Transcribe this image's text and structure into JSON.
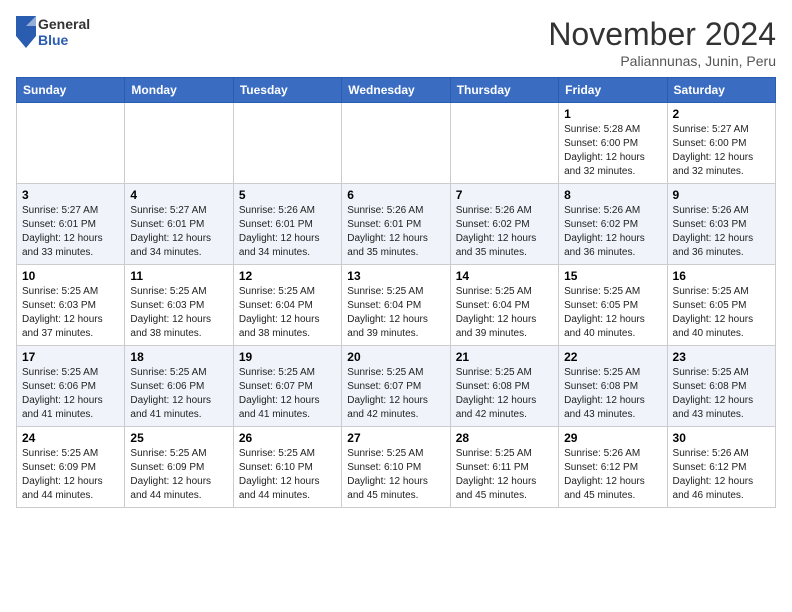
{
  "header": {
    "logo_general": "General",
    "logo_blue": "Blue",
    "month": "November 2024",
    "location": "Paliannunas, Junin, Peru"
  },
  "weekdays": [
    "Sunday",
    "Monday",
    "Tuesday",
    "Wednesday",
    "Thursday",
    "Friday",
    "Saturday"
  ],
  "weeks": [
    [
      {
        "day": "",
        "info": ""
      },
      {
        "day": "",
        "info": ""
      },
      {
        "day": "",
        "info": ""
      },
      {
        "day": "",
        "info": ""
      },
      {
        "day": "",
        "info": ""
      },
      {
        "day": "1",
        "info": "Sunrise: 5:28 AM\nSunset: 6:00 PM\nDaylight: 12 hours and 32 minutes."
      },
      {
        "day": "2",
        "info": "Sunrise: 5:27 AM\nSunset: 6:00 PM\nDaylight: 12 hours and 32 minutes."
      }
    ],
    [
      {
        "day": "3",
        "info": "Sunrise: 5:27 AM\nSunset: 6:01 PM\nDaylight: 12 hours and 33 minutes."
      },
      {
        "day": "4",
        "info": "Sunrise: 5:27 AM\nSunset: 6:01 PM\nDaylight: 12 hours and 34 minutes."
      },
      {
        "day": "5",
        "info": "Sunrise: 5:26 AM\nSunset: 6:01 PM\nDaylight: 12 hours and 34 minutes."
      },
      {
        "day": "6",
        "info": "Sunrise: 5:26 AM\nSunset: 6:01 PM\nDaylight: 12 hours and 35 minutes."
      },
      {
        "day": "7",
        "info": "Sunrise: 5:26 AM\nSunset: 6:02 PM\nDaylight: 12 hours and 35 minutes."
      },
      {
        "day": "8",
        "info": "Sunrise: 5:26 AM\nSunset: 6:02 PM\nDaylight: 12 hours and 36 minutes."
      },
      {
        "day": "9",
        "info": "Sunrise: 5:26 AM\nSunset: 6:03 PM\nDaylight: 12 hours and 36 minutes."
      }
    ],
    [
      {
        "day": "10",
        "info": "Sunrise: 5:25 AM\nSunset: 6:03 PM\nDaylight: 12 hours and 37 minutes."
      },
      {
        "day": "11",
        "info": "Sunrise: 5:25 AM\nSunset: 6:03 PM\nDaylight: 12 hours and 38 minutes."
      },
      {
        "day": "12",
        "info": "Sunrise: 5:25 AM\nSunset: 6:04 PM\nDaylight: 12 hours and 38 minutes."
      },
      {
        "day": "13",
        "info": "Sunrise: 5:25 AM\nSunset: 6:04 PM\nDaylight: 12 hours and 39 minutes."
      },
      {
        "day": "14",
        "info": "Sunrise: 5:25 AM\nSunset: 6:04 PM\nDaylight: 12 hours and 39 minutes."
      },
      {
        "day": "15",
        "info": "Sunrise: 5:25 AM\nSunset: 6:05 PM\nDaylight: 12 hours and 40 minutes."
      },
      {
        "day": "16",
        "info": "Sunrise: 5:25 AM\nSunset: 6:05 PM\nDaylight: 12 hours and 40 minutes."
      }
    ],
    [
      {
        "day": "17",
        "info": "Sunrise: 5:25 AM\nSunset: 6:06 PM\nDaylight: 12 hours and 41 minutes."
      },
      {
        "day": "18",
        "info": "Sunrise: 5:25 AM\nSunset: 6:06 PM\nDaylight: 12 hours and 41 minutes."
      },
      {
        "day": "19",
        "info": "Sunrise: 5:25 AM\nSunset: 6:07 PM\nDaylight: 12 hours and 41 minutes."
      },
      {
        "day": "20",
        "info": "Sunrise: 5:25 AM\nSunset: 6:07 PM\nDaylight: 12 hours and 42 minutes."
      },
      {
        "day": "21",
        "info": "Sunrise: 5:25 AM\nSunset: 6:08 PM\nDaylight: 12 hours and 42 minutes."
      },
      {
        "day": "22",
        "info": "Sunrise: 5:25 AM\nSunset: 6:08 PM\nDaylight: 12 hours and 43 minutes."
      },
      {
        "day": "23",
        "info": "Sunrise: 5:25 AM\nSunset: 6:08 PM\nDaylight: 12 hours and 43 minutes."
      }
    ],
    [
      {
        "day": "24",
        "info": "Sunrise: 5:25 AM\nSunset: 6:09 PM\nDaylight: 12 hours and 44 minutes."
      },
      {
        "day": "25",
        "info": "Sunrise: 5:25 AM\nSunset: 6:09 PM\nDaylight: 12 hours and 44 minutes."
      },
      {
        "day": "26",
        "info": "Sunrise: 5:25 AM\nSunset: 6:10 PM\nDaylight: 12 hours and 44 minutes."
      },
      {
        "day": "27",
        "info": "Sunrise: 5:25 AM\nSunset: 6:10 PM\nDaylight: 12 hours and 45 minutes."
      },
      {
        "day": "28",
        "info": "Sunrise: 5:25 AM\nSunset: 6:11 PM\nDaylight: 12 hours and 45 minutes."
      },
      {
        "day": "29",
        "info": "Sunrise: 5:26 AM\nSunset: 6:12 PM\nDaylight: 12 hours and 45 minutes."
      },
      {
        "day": "30",
        "info": "Sunrise: 5:26 AM\nSunset: 6:12 PM\nDaylight: 12 hours and 46 minutes."
      }
    ]
  ]
}
